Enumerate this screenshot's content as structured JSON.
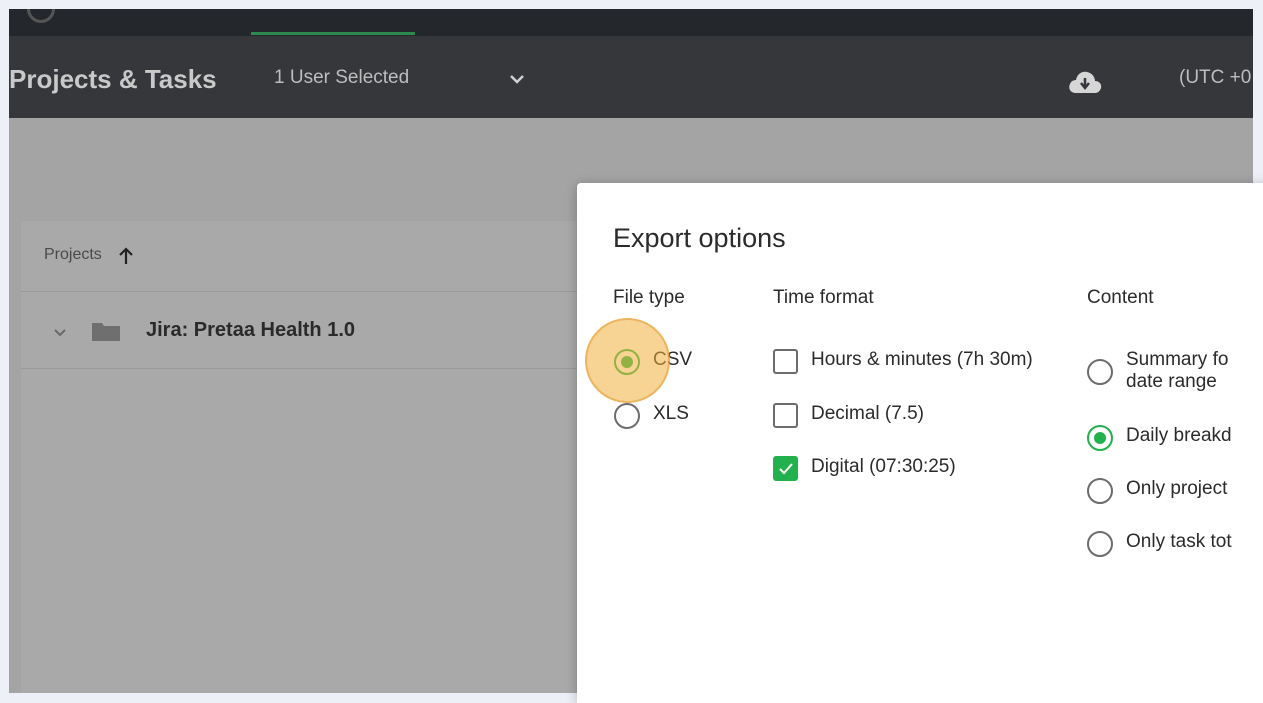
{
  "header": {
    "title": "Projects & Tasks",
    "user_select_label": "1 User Selected",
    "timezone": "(UTC +0"
  },
  "table": {
    "column_header": "Projects",
    "rows": [
      {
        "name": "Jira: Pretaa Health 1.0"
      }
    ]
  },
  "modal": {
    "title": "Export options",
    "file_type": {
      "title": "File type",
      "options": [
        {
          "label": "CSV",
          "selected": true
        },
        {
          "label": "XLS",
          "selected": false
        }
      ]
    },
    "time_format": {
      "title": "Time format",
      "options": [
        {
          "label": "Hours & minutes (7h 30m)",
          "checked": false
        },
        {
          "label": "Decimal (7.5)",
          "checked": false
        },
        {
          "label": "Digital (07:30:25)",
          "checked": true
        }
      ]
    },
    "content": {
      "title": "Content",
      "options": [
        {
          "label_line1": "Summary fo",
          "label_line2": "date range",
          "selected": false
        },
        {
          "label": "Daily breakd",
          "selected": true
        },
        {
          "label": "Only project",
          "selected": false
        },
        {
          "label": "Only task tot",
          "selected": false
        }
      ]
    }
  },
  "colors": {
    "accent": "#22b14c",
    "header_bg": "#35373b",
    "click_highlight": "#f0b03c"
  }
}
